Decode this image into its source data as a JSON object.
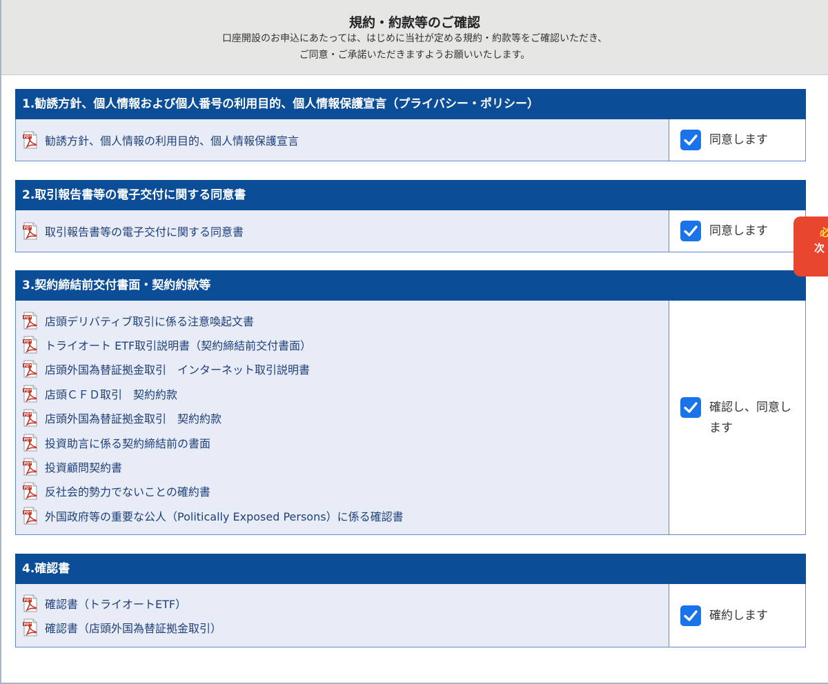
{
  "header": {
    "title": "規約・約款等のご確認",
    "desc_line1": "口座開設のお申込にあたっては、はじめに当社が定める規約・約款等をご確認いただき、",
    "desc_line2": "ご同意・ご承諾いただきますようお願いいたします。"
  },
  "sections": [
    {
      "heading": "1.勧誘方針、個人情報および個人番号の利用目的、個人情報保護宣言（プライバシー・ポリシー）",
      "docs": [
        "勧誘方針、個人情報の利用目的、個人情報保護宣言"
      ],
      "agree_label": "同意します",
      "checked": true
    },
    {
      "heading": "2.取引報告書等の電子交付に関する同意書",
      "docs": [
        "取引報告書等の電子交付に関する同意書"
      ],
      "agree_label": "同意します",
      "checked": true
    },
    {
      "heading": "3.契約締結前交付書面・契約約款等",
      "docs": [
        "店頭デリバティブ取引に係る注意喚起文書",
        "トライオート ETF取引説明書（契約締結前交付書面）",
        "店頭外国為替証拠金取引　インターネット取引説明書",
        "店頭ＣＦＤ取引　契約約款",
        "店頭外国為替証拠金取引　契約約款",
        "投資助言に係る契約締結前の書面",
        "投資顧問契約書",
        "反社会的勢力でないことの確約書",
        "外国政府等の重要な公人（Politically Exposed Persons）に係る確認書"
      ],
      "agree_label": "確認し、同意します",
      "checked": true
    },
    {
      "heading": "4.確認書",
      "docs": [
        "確認書（トライオートETF）",
        "確認書（店頭外国為替証拠金取引）"
      ],
      "agree_label": "確約します",
      "checked": true
    }
  ],
  "side_tab": {
    "line1": "必",
    "line2": "次"
  },
  "colors": {
    "heading_bg": "#0b4e97",
    "checkbox": "#1a73e8",
    "side_tab": "#e8462e"
  }
}
